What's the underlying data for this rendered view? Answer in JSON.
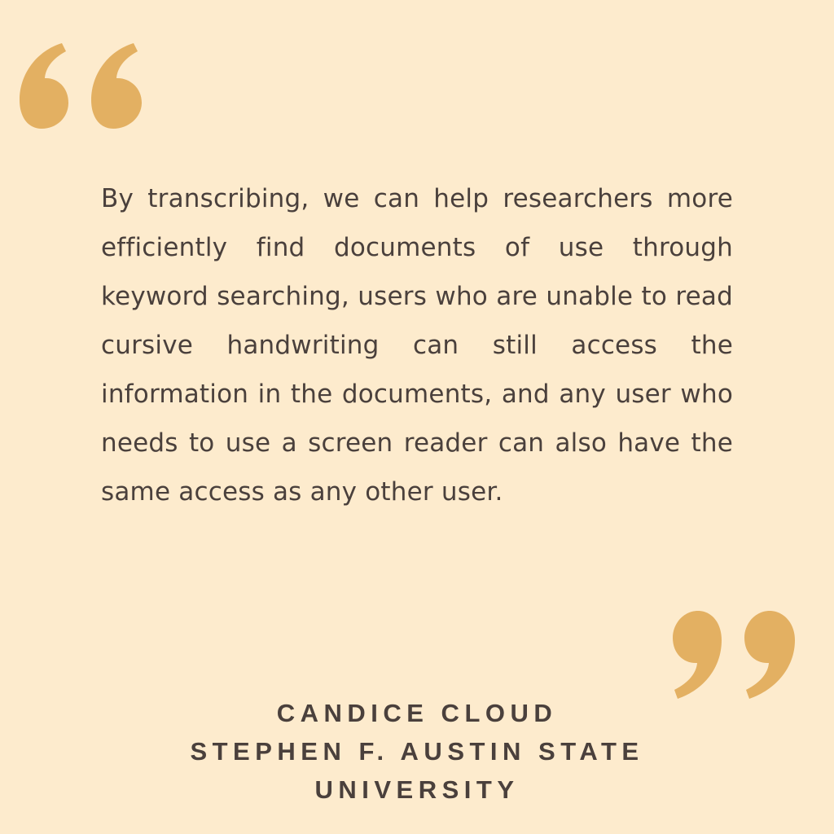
{
  "colors": {
    "background": "#fdebcd",
    "accent": "#e3b062",
    "text": "#4a403c"
  },
  "icons": {
    "open_quote": "open-quote-icon",
    "close_quote": "close-quote-icon"
  },
  "quote": {
    "text": "By transcribing, we can help researchers more efficiently find documents of use through keyword searching, users who are unable to read cursive handwriting can still access the information in the documents, and any user who needs to use a screen reader can also have the same access as any other user."
  },
  "attribution": {
    "name": "CANDICE CLOUD",
    "affiliation_line1": "STEPHEN F. AUSTIN STATE",
    "affiliation_line2": "UNIVERSITY"
  }
}
